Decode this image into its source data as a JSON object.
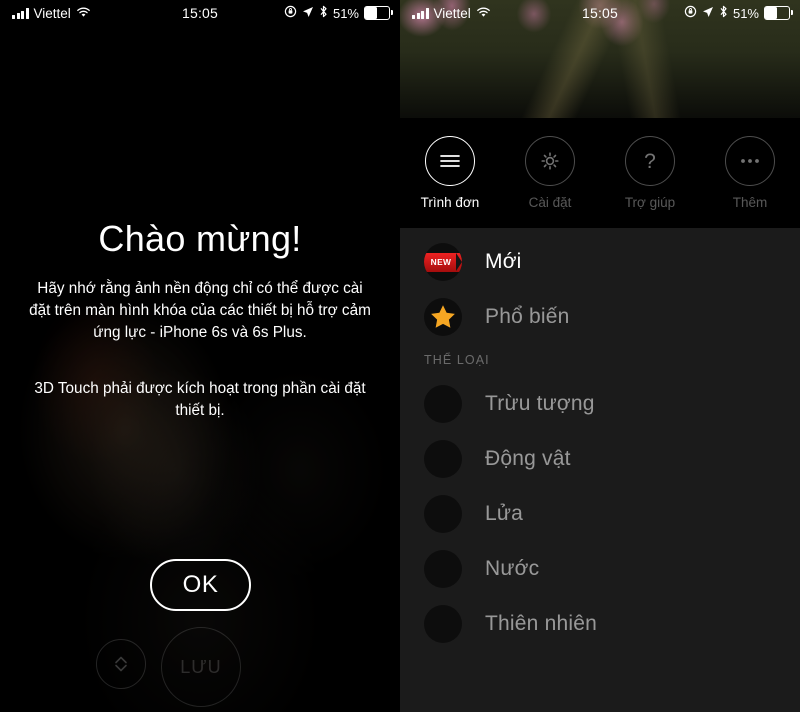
{
  "status_bar": {
    "carrier": "Viettel",
    "time": "15:05",
    "battery_percent": "51%",
    "icons": [
      "signal-bars-icon",
      "wifi-icon",
      "rotation-lock-icon",
      "location-arrow-icon",
      "bluetooth-icon",
      "battery-icon"
    ]
  },
  "left_screen": {
    "title": "Chào mừng!",
    "paragraph1": "Hãy nhớ rằng ảnh nền động chỉ có thể được cài đặt trên màn hình khóa của các thiết bị hỗ trợ cảm ứng lực - iPhone 6s và 6s Plus.",
    "paragraph2": "3D Touch phải được kích hoạt trong phần cài đặt thiết bị.",
    "ok_button": "OK",
    "save_button": "LƯU",
    "chevron_button": "chevron-up-down-icon"
  },
  "right_screen": {
    "top_chevron": "chevron-up-down-icon",
    "toolbar": [
      {
        "label": "Trình đơn",
        "icon": "hamburger-menu-icon",
        "active": true
      },
      {
        "label": "Cài đặt",
        "icon": "gear-icon",
        "active": false
      },
      {
        "label": "Trợ giúp",
        "icon": "question-mark-icon",
        "active": false
      },
      {
        "label": "Thêm",
        "icon": "ellipsis-icon",
        "active": false
      }
    ],
    "menu": {
      "top_items": [
        {
          "label": "Mới",
          "icon": "new-ribbon-badge-icon",
          "badge": "NEW"
        },
        {
          "label": "Phổ biến",
          "icon": "star-icon"
        }
      ],
      "section_title": "THỂ LOẠI",
      "categories": [
        {
          "label": "Trừu tượng",
          "icon": "abstract-swirl-icon"
        },
        {
          "label": "Động vật",
          "icon": "lion-head-icon"
        },
        {
          "label": "Lửa",
          "icon": "flame-icon"
        },
        {
          "label": "Nước",
          "icon": "water-wave-icon"
        },
        {
          "label": "Thiên nhiên",
          "icon": "nature-leaf-icon"
        }
      ]
    }
  },
  "colors": {
    "accent_red": "#e22222",
    "accent_orange": "#f0a020",
    "panel_bg": "#1b1b1b",
    "screen_bg": "#000000"
  }
}
